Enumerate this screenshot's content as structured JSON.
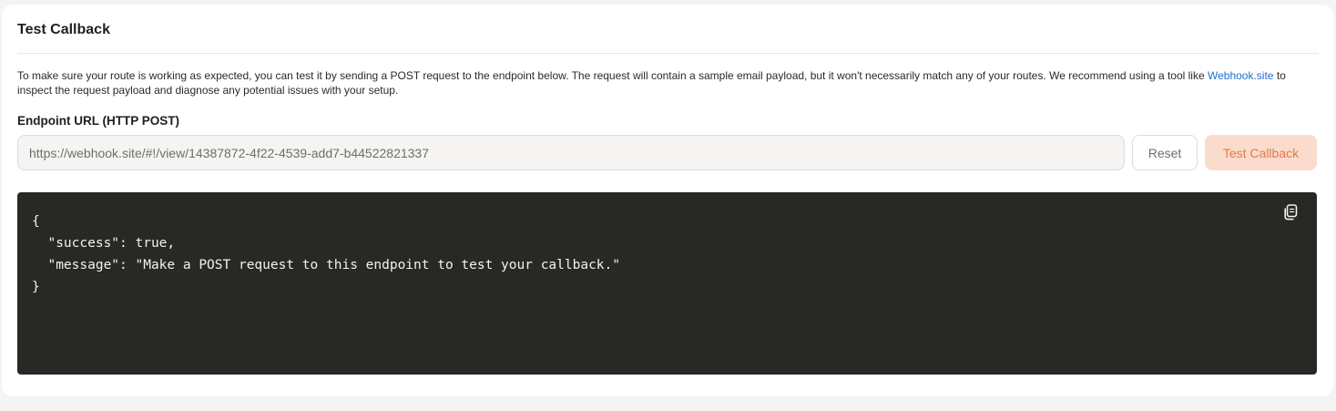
{
  "card": {
    "title": "Test Callback",
    "description_before_link": "To make sure your route is working as expected, you can test it by sending a POST request to the endpoint below. The request will contain a sample email payload, but it won't necessarily match any of your routes. We recommend using a tool like ",
    "link_text": "Webhook.site",
    "description_after_link": " to inspect the request payload and diagnose any potential issues with your setup."
  },
  "endpoint": {
    "label": "Endpoint URL (HTTP POST)",
    "value": "https://webhook.site/#!/view/14387872-4f22-4539-add7-b44522821337"
  },
  "buttons": {
    "reset_label": "Reset",
    "test_label": "Test Callback"
  },
  "response": {
    "code": "{\n  \"success\": true,\n  \"message\": \"Make a POST request to this endpoint to test your callback.\"\n}",
    "copy_icon": "copy-icon"
  },
  "colors": {
    "accent_bg": "#fbdccc",
    "accent_text": "#e07a4c",
    "link": "#1f6fd1",
    "code_bg": "#282924"
  }
}
